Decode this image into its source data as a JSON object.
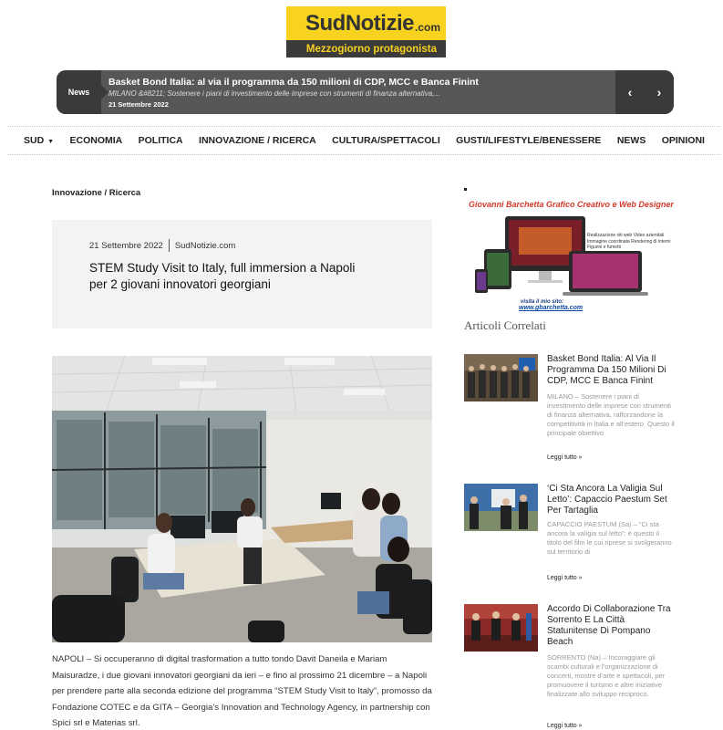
{
  "logo": {
    "brand": "SudNotizie",
    "tld": ".com",
    "tagline": "Mezzogiorno protagonista"
  },
  "ticker": {
    "tag": "News",
    "title": "Basket Bond Italia: al via il programma da 150 milioni di CDP, MCC e Banca Finint",
    "excerpt": "MILANO &#8211; Sostenere i piani di investimento delle imprese con strumenti di finanza alternativa,...",
    "date": "21 Settembre 2022",
    "prev": "‹",
    "next": "›"
  },
  "nav": {
    "items": [
      "SUD",
      "ECONOMIA",
      "POLITICA",
      "INNOVAZIONE / RICERCA",
      "CULTURA/SPETTACOLI",
      "GUSTI/LIFESTYLE/BENESSERE",
      "NEWS",
      "OPINIONI"
    ],
    "caret": "▼"
  },
  "article": {
    "category": "Innovazione / Ricerca",
    "date": "21 Settembre 2022",
    "source": "SudNotizie.com",
    "title": "STEM Study Visit to Italy, full immersion a Napoli per 2 giovani innovatori georgiani",
    "body": "NAPOLI – Si occuperanno di digital trasformation a tutto tondo Davit Daneila e Mariam Maisuradze, i due giovani innovatori georgiani da ieri – e fino al prossimo 21 dicembre – a Napoli per prendere parte alla seconda edizione del programma “STEM Study Visit to Italy”, promosso da Fondazione COTEC e da GITA – Georgia’s Innovation and Technology Agency, in partnership con Spici srl e Materias srl."
  },
  "sidebar": {
    "ad": {
      "title": "Giovanni Barchetta Grafico Creativo e Web Designer",
      "desc": "Realizzazione siti web Video aziendali Immagine coordinata Rendering di interni Figurini e fumetti",
      "visit": "visita il mio sito:",
      "url": "www.gbarchetta.com"
    },
    "related_heading": "Articoli Correlati",
    "related": [
      {
        "title": "Basket Bond Italia: Al Via Il Programma Da 150 Milioni Di CDP, MCC E Banca Finint",
        "excerpt": "MILANO – Sostenere i piani di investimento delle imprese con strumenti di finanza alternativa, rafforzandone la competitività in Italia e all’estero. Questo il principale obiettivo",
        "more": "Leggi tutto »"
      },
      {
        "title": "‘Ci Sta Ancora La Valigia Sul Letto’: Capaccio Paestum Set Per Tartaglia",
        "excerpt": "CAPACCIO PAESTUM (Sa) – “Ci sta ancora la valigia sul letto”: è questo il titolo del film le cui riprese si svolgeranno sul territorio di",
        "more": "Leggi tutto »"
      },
      {
        "title": "Accordo Di Collaborazione Tra Sorrento E La Città Statunitense Di Pompano Beach",
        "excerpt": "SORRENTO (Na) – Incoraggiare gli scambi culturali e l’organizzazione di concerti, mostre d’arte e spettacoli, per promuovere il turismo e altre iniziative finalizzate allo sviluppo reciproco.",
        "more": "Leggi tutto »"
      }
    ]
  }
}
